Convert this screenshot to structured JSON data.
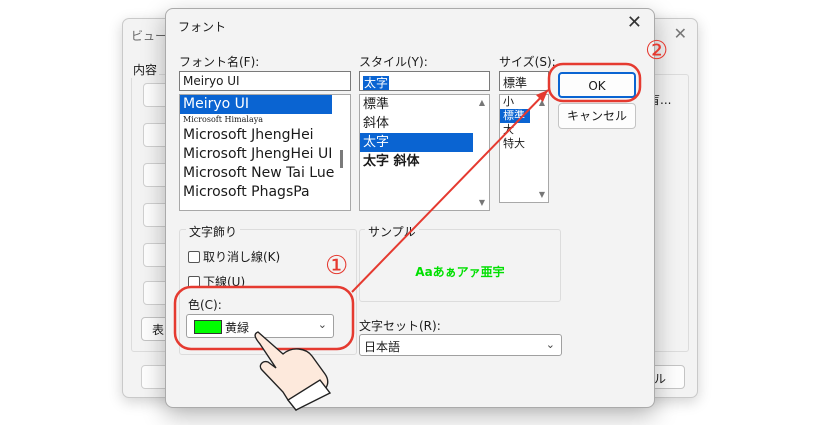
{
  "background_dialog": {
    "title": "ビューの",
    "group_label": "内容",
    "show_button_label": "表",
    "right_text": "盲...",
    "cancel_label": "セル"
  },
  "font_dialog": {
    "title": "フォント",
    "font_name": {
      "label": "フォント名(F):",
      "value": "Meiryo UI",
      "items": [
        {
          "label": "Meiryo UI",
          "selected": true,
          "small": false
        },
        {
          "label": "Microsoft Himalaya",
          "selected": false,
          "small": true
        },
        {
          "label": "Microsoft JhengHei",
          "selected": false,
          "small": false
        },
        {
          "label": "Microsoft JhengHei UI",
          "selected": false,
          "small": false
        },
        {
          "label": "Microsoft New Tai Lue",
          "selected": false,
          "small": false
        },
        {
          "label": "Microsoft PhagsPa",
          "selected": false,
          "small": false
        }
      ]
    },
    "style": {
      "label": "スタイル(Y):",
      "value": "太字",
      "items": [
        {
          "label": "標準",
          "selected": false,
          "bold": false
        },
        {
          "label": "斜体",
          "selected": false,
          "bold": false
        },
        {
          "label": "太字",
          "selected": true,
          "bold": true
        },
        {
          "label": "太字 斜体",
          "selected": false,
          "bold": true
        }
      ]
    },
    "size": {
      "label": "サイズ(S):",
      "value": "標準",
      "items": [
        {
          "label": "小",
          "selected": false
        },
        {
          "label": "標準",
          "selected": true
        },
        {
          "label": "大",
          "selected": false
        },
        {
          "label": "特大",
          "selected": false
        }
      ]
    },
    "ok_label": "OK",
    "cancel_label": "キャンセル",
    "effects": {
      "label": "文字飾り",
      "strikeout_label": "取り消し線(K)",
      "strikeout_checked": false,
      "underline_label": "下線(U)",
      "underline_checked": false,
      "color_label": "色(C):",
      "color_value": "黄緑",
      "color_hex": "#00ff00"
    },
    "sample": {
      "label": "サンプル",
      "text": "Aaあぁアァ亜宇",
      "color": "#00e000"
    },
    "charset": {
      "label": "文字セット(R):",
      "value": "日本語"
    }
  },
  "annotations": {
    "step1": "①",
    "step2": "②",
    "color": "#e53a30"
  }
}
